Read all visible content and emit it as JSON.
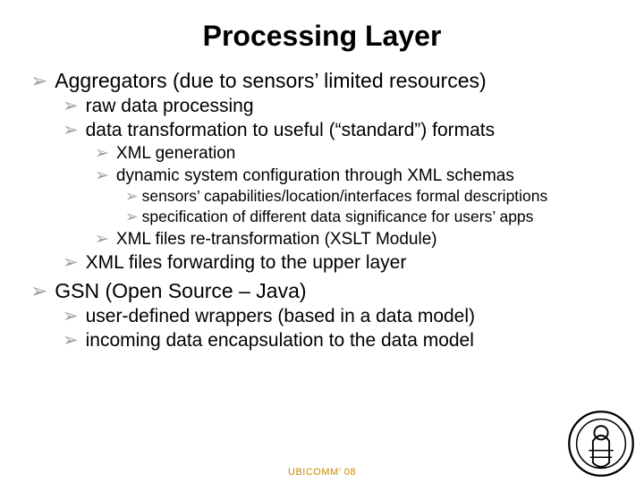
{
  "title": "Processing Layer",
  "bullets": {
    "i0": "Aggregators (due to sensors’ limited resources)",
    "i0_0": "raw data processing",
    "i0_1": "data transformation to useful (“standard”) formats",
    "i0_1_0": "XML generation",
    "i0_1_1": "dynamic system configuration through XML schemas",
    "i0_1_1_0": "sensors’ capabilities/location/interfaces formal descriptions",
    "i0_1_1_1": "specification of different data significance for users’ apps",
    "i0_1_2": "XML files re-transformation (XSLT Module)",
    "i0_2": "XML files forwarding to the upper layer",
    "i1": "GSN (Open Source – Java)",
    "i1_0": "user-defined wrappers (based in a data model)",
    "i1_1": "incoming data encapsulation to the data model"
  },
  "footer": "UBICOMM’ 08"
}
